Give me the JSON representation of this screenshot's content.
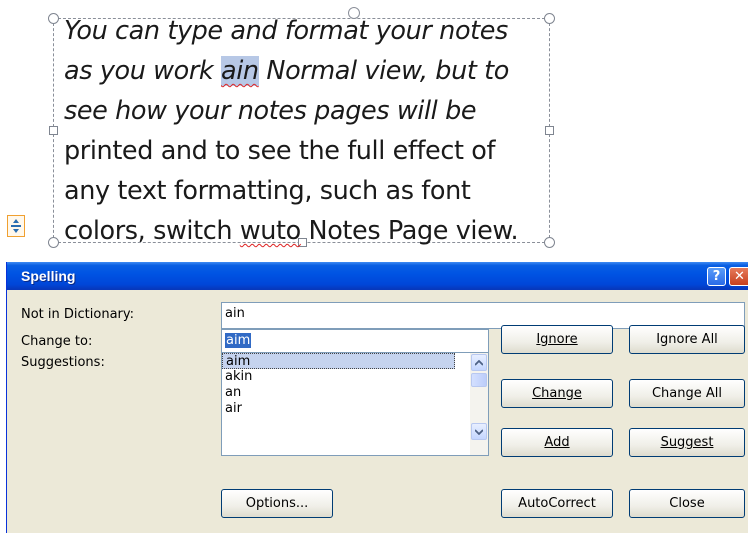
{
  "notes": {
    "line1": "You can type and format your notes",
    "line2_before": "as you work ",
    "line2_selected": "ain",
    "line2_after": " Normal view, but to",
    "line3": "see how your notes pages will be",
    "line4": "printed and to see the full effect of",
    "line5": "any text formatting, such as font",
    "line6_before": "colors, switch ",
    "line6_misspelled": "wuto",
    "line6_after": " Notes Page view."
  },
  "dialog": {
    "title": "Spelling",
    "help_button": "?",
    "close_button": "✕",
    "not_in_dictionary_label": "Not in Dictionary:",
    "not_in_dictionary_value": "ain",
    "change_to_label": "Change to:",
    "change_to_value": "aim",
    "suggestions_label": "Suggestions:",
    "suggestions": [
      "aim",
      "akin",
      "an",
      "air"
    ],
    "buttons": {
      "ignore": "Ignore",
      "ignore_all": "Ignore All",
      "change": "Change",
      "change_all": "Change All",
      "add": "Add",
      "suggest": "Suggest",
      "options": "Options...",
      "autocorrect": "AutoCorrect",
      "close": "Close"
    }
  },
  "colors": {
    "titlebar": "#0054E3",
    "dialog_bg": "#ECE9D8",
    "selection": "#316AC5"
  },
  "icons": [
    "layout-options-icon",
    "scroll-up-icon",
    "scroll-down-icon"
  ]
}
